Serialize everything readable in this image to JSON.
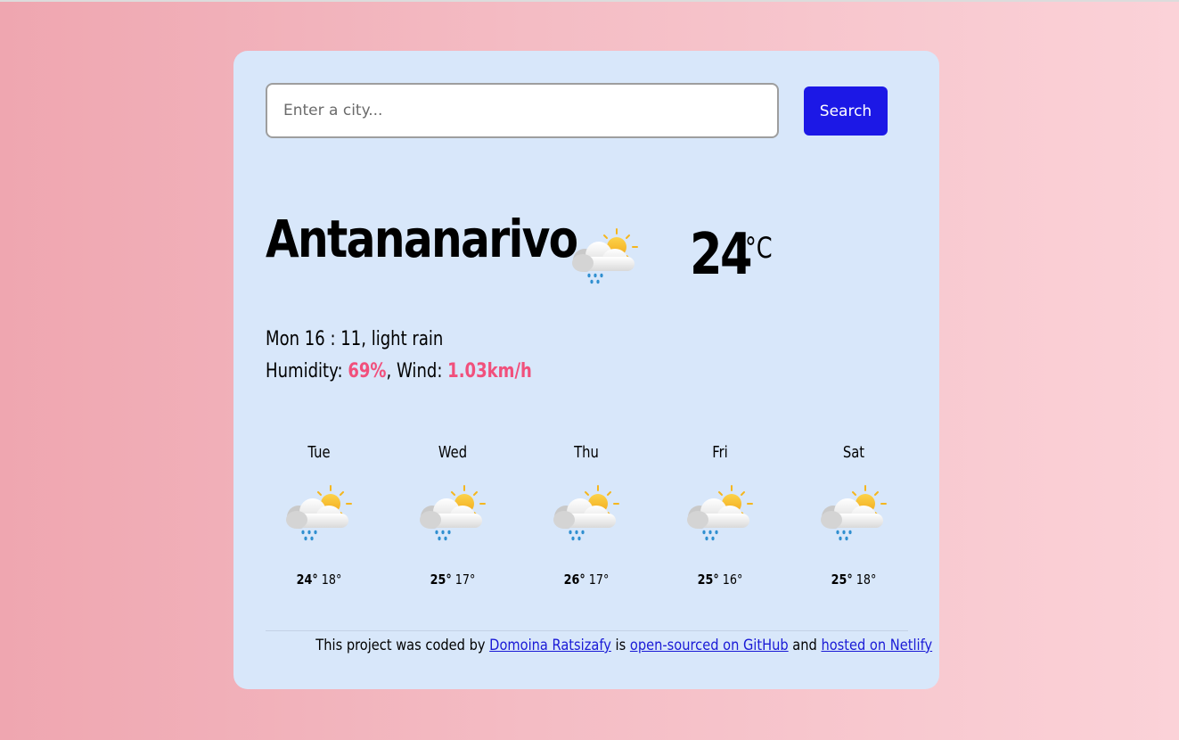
{
  "search": {
    "placeholder": "Enter a city...",
    "button_label": "Search"
  },
  "current": {
    "city": "Antananarivo",
    "icon": "sun-cloud-rain-icon",
    "temperature": "24",
    "unit": "°C",
    "datetime": "Mon 16 : 11",
    "description": "light rain",
    "humidity_label": "Humidity:",
    "humidity_value": "69%",
    "wind_label": "Wind:",
    "wind_value": "1.03km/h"
  },
  "forecast": [
    {
      "day": "Tue",
      "icon": "sun-cloud-rain-icon",
      "max": "24°",
      "min": "18°"
    },
    {
      "day": "Wed",
      "icon": "sun-cloud-rain-icon",
      "max": "25°",
      "min": "17°"
    },
    {
      "day": "Thu",
      "icon": "sun-cloud-rain-icon",
      "max": "26°",
      "min": "17°"
    },
    {
      "day": "Fri",
      "icon": "sun-cloud-rain-icon",
      "max": "25°",
      "min": "16°"
    },
    {
      "day": "Sat",
      "icon": "sun-cloud-rain-icon",
      "max": "25°",
      "min": "18°"
    }
  ],
  "footer": {
    "text1": "This project was coded by",
    "author_link": "Domoina Ratsizafy",
    "text2": "is",
    "github_link": "open-sourced on GitHub",
    "text3": "and",
    "netlify_link": "hosted on Netlify"
  },
  "colors": {
    "accent": "#f1507c",
    "button": "#1c18e6",
    "card": "#d8e7fa",
    "link": "#1a1ad6"
  }
}
